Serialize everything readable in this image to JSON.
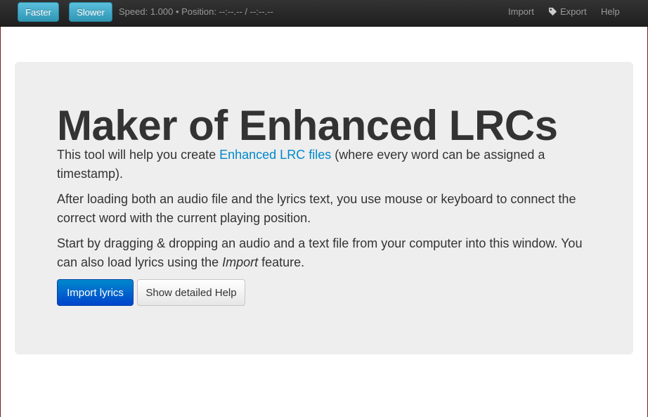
{
  "navbar": {
    "faster_label": "Faster",
    "slower_label": "Slower",
    "status_text": "Speed: 1.000 • Position: --:--.-- / --:--.--",
    "import_label": "Import",
    "export_label": "Export",
    "help_label": "Help"
  },
  "hero": {
    "title": "Maker of Enhanced LRCs",
    "p1_before": "This tool will help you create ",
    "p1_link": "Enhanced LRC files",
    "p1_after": " (where every word can be assigned a timestamp).",
    "p2": "After loading both an audio file and the lyrics text, you use mouse or keyboard to connect the correct word with the current playing position.",
    "p3_before": "Start by dragging & dropping an audio and a text file from your computer into this window. You can also load lyrics using the ",
    "p3_em": "Import",
    "p3_after": " feature.",
    "import_button": "Import lyrics",
    "help_button": "Show detailed Help"
  },
  "colors": {
    "navbar_bg": "#222222",
    "info_button": "#2f96b4",
    "primary_button": "#0055cc",
    "link": "#0088cc",
    "hero_bg": "#eeeeee"
  },
  "icons": [
    "tag-icon"
  ]
}
